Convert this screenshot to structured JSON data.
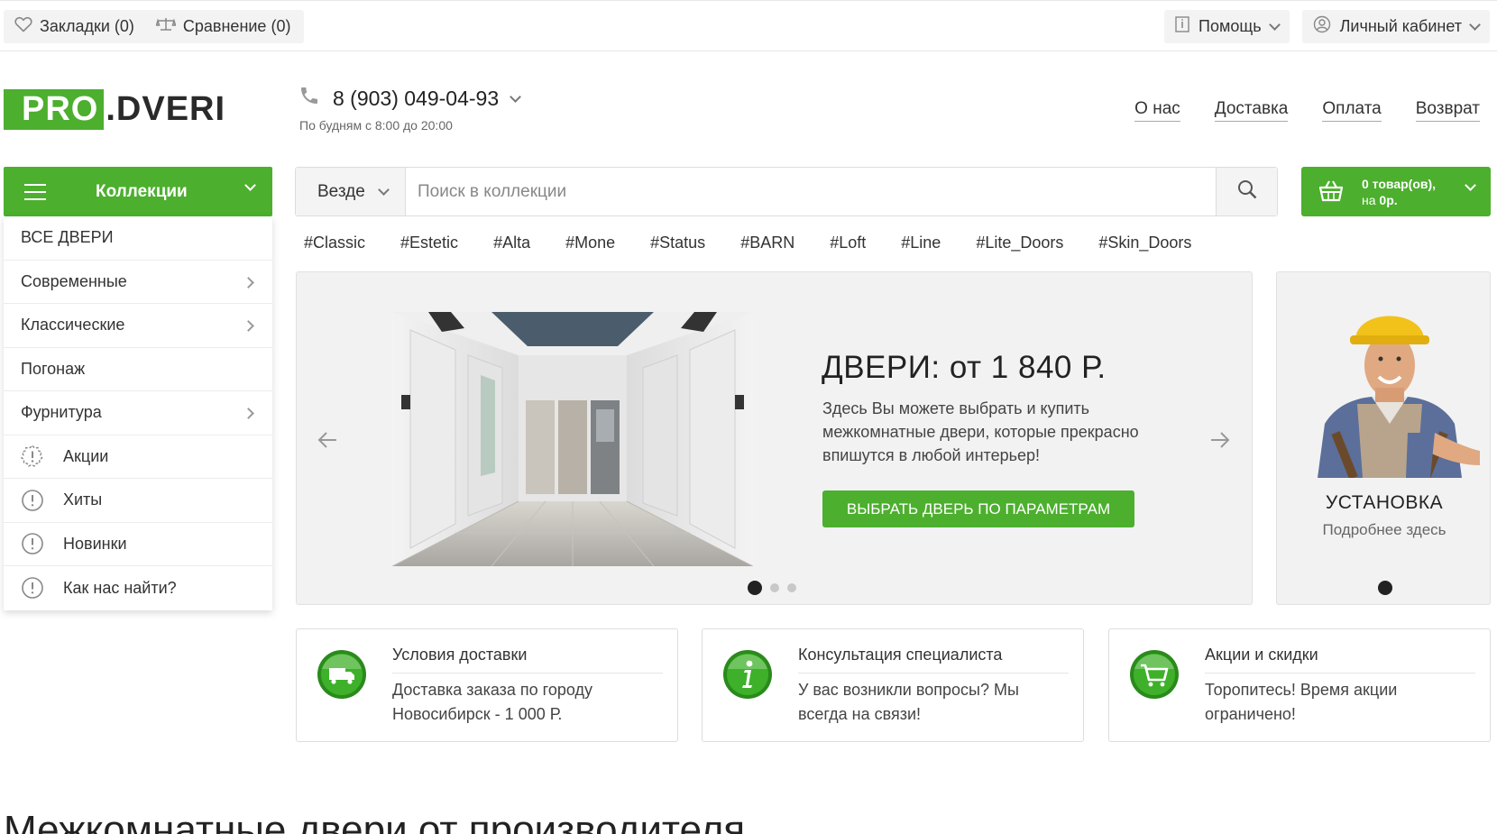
{
  "topbar": {
    "bookmarks": "Закладки (0)",
    "compare": "Сравнение (0)",
    "help": "Помощь",
    "account": "Личный кабинет"
  },
  "header": {
    "logo_left": "PRO",
    "logo_right": ".DVERI",
    "phone": "8 (903) 049-04-93",
    "hours": "По будням с 8:00 до 20:00",
    "nav": [
      "О нас",
      "Доставка",
      "Оплата",
      "Возврат"
    ]
  },
  "catalog": {
    "button_label": "Коллекции",
    "items": [
      {
        "label": "ВСЕ ДВЕРИ",
        "icon": "",
        "submenu": false
      },
      {
        "label": "Современные",
        "icon": "",
        "submenu": true
      },
      {
        "label": "Классические",
        "icon": "",
        "submenu": true
      },
      {
        "label": "Погонаж",
        "icon": "",
        "submenu": false
      },
      {
        "label": "Фурнитура",
        "icon": "",
        "submenu": true
      },
      {
        "label": "Акции",
        "icon": "badge-icon",
        "submenu": false
      },
      {
        "label": "Хиты",
        "icon": "exclamation-icon",
        "submenu": false
      },
      {
        "label": "Новинки",
        "icon": "exclamation-icon",
        "submenu": false
      },
      {
        "label": "Как нас найти?",
        "icon": "exclamation-icon",
        "submenu": false
      }
    ]
  },
  "search": {
    "scope": "Везде",
    "placeholder": "Поиск в коллекции"
  },
  "cart": {
    "line1": "0 товар(ов),",
    "line2_prefix": "на",
    "line2_amount": "0р."
  },
  "tags": [
    "#Classic",
    "#Estetic",
    "#Alta",
    "#Mone",
    "#Status",
    "#BARN",
    "#Loft",
    "#Line",
    "#Lite_Doors",
    "#Skin_Doors"
  ],
  "slider": {
    "title": "ДВЕРИ: от 1 840 Р.",
    "text": "Здесь Вы можете выбрать и купить межкомнатные двери, которые прекрасно впишутся в любой интерьер!",
    "button": "ВЫБРАТЬ ДВЕРЬ ПО ПАРАМЕТРАМ",
    "dots": 3,
    "active_dot": 0
  },
  "side_banner": {
    "title": "УСТАНОВКА",
    "subtitle": "Подробнее здесь"
  },
  "info_cards": [
    {
      "title": "Условия доставки",
      "text": "Доставка заказа по городу Новосибирск - 1 000 Р.",
      "icon": "truck-icon"
    },
    {
      "title": "Консультация специалиста",
      "text": "У вас возникли вопросы? Мы всегда на связи!",
      "icon": "info-icon"
    },
    {
      "title": "Акции и скидки",
      "text": "Торопитесь! Время акции ограничено!",
      "icon": "cart-icon"
    }
  ],
  "page_heading": "Межкомнатные двери от производителя",
  "colors": {
    "brand_green": "#4caf2e",
    "text": "#333333",
    "panel_bg": "#f2f2f2"
  }
}
